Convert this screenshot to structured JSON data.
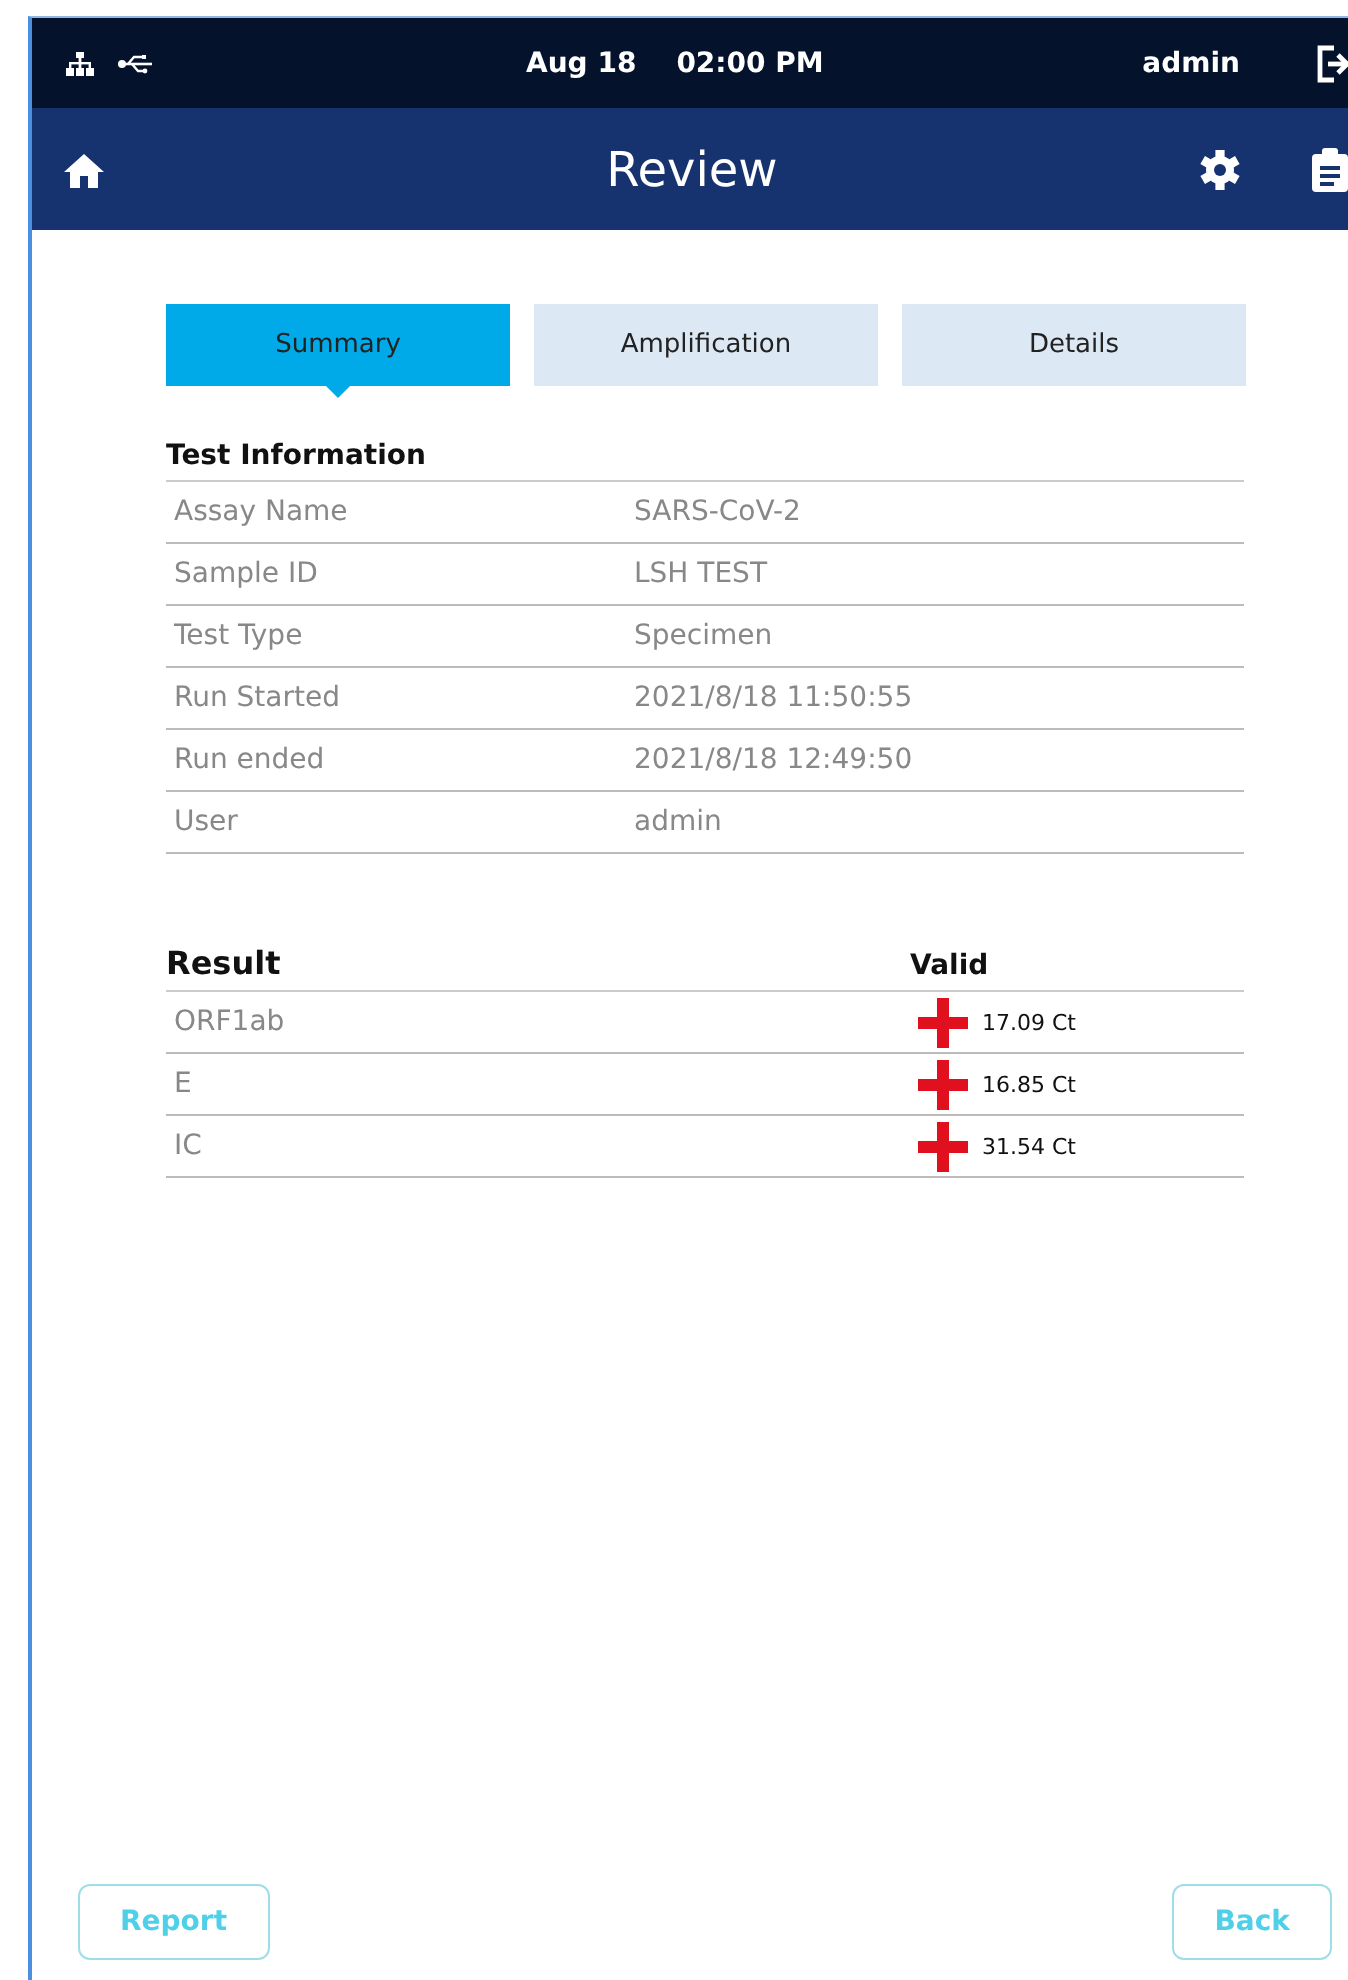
{
  "status_bar": {
    "date": "Aug 18",
    "time": "02:00 PM",
    "user": "admin"
  },
  "header": {
    "title": "Review"
  },
  "tabs": [
    {
      "label": "Summary",
      "selected": true
    },
    {
      "label": "Amplification",
      "selected": false
    },
    {
      "label": "Details",
      "selected": false
    }
  ],
  "test_information": {
    "title": "Test Information",
    "rows": [
      {
        "label": "Assay Name",
        "value": "SARS-CoV-2"
      },
      {
        "label": "Sample ID",
        "value": "LSH TEST"
      },
      {
        "label": "Test Type",
        "value": "Specimen"
      },
      {
        "label": "Run Started",
        "value": "2021/8/18 11:50:55"
      },
      {
        "label": "Run ended",
        "value": "2021/8/18 12:49:50"
      },
      {
        "label": "User",
        "value": "admin"
      }
    ]
  },
  "result": {
    "title": "Result",
    "validity": "Valid",
    "rows": [
      {
        "target": "ORF1ab",
        "positive": true,
        "ct": "17.09 Ct"
      },
      {
        "target": "E",
        "positive": true,
        "ct": "16.85 Ct"
      },
      {
        "target": "IC",
        "positive": true,
        "ct": "31.54 Ct"
      }
    ]
  },
  "buttons": [
    {
      "label": "Report"
    },
    {
      "label": "Back"
    }
  ]
}
